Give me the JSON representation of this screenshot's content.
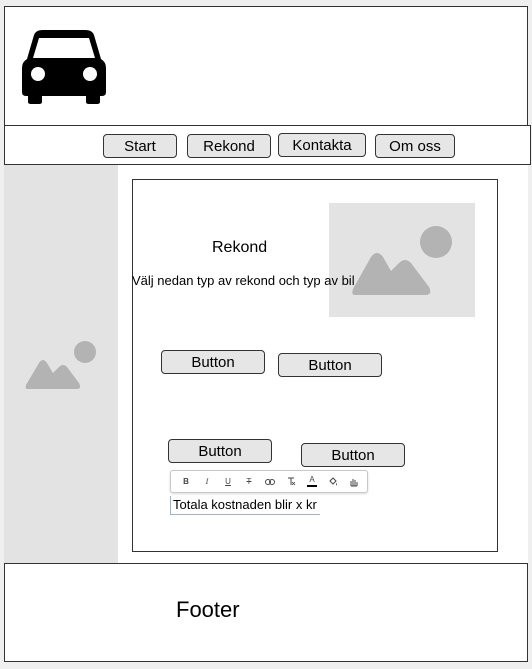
{
  "nav": {
    "items": [
      "Start",
      "Rekond",
      "Kontakta",
      "Om oss"
    ]
  },
  "main": {
    "title": "Rekond",
    "description": "Välj nedan typ av rekond och typ av bil",
    "buttons": [
      "Button",
      "Button",
      "Button",
      "Button"
    ],
    "editor_text": "Totala kostnaden blir x kr"
  },
  "toolbar": {
    "bold": "B",
    "italic": "I",
    "underline": "U",
    "strike": "T",
    "text_color": "A"
  },
  "footer": {
    "text": "Footer"
  },
  "icons": {
    "logo": "car-icon",
    "image_placeholder": "image-placeholder-icon"
  },
  "colors": {
    "placeholder_gray": "#e3e3e3",
    "placeholder_icon": "#b3b3b3",
    "button_fill": "#e6e6e6"
  }
}
